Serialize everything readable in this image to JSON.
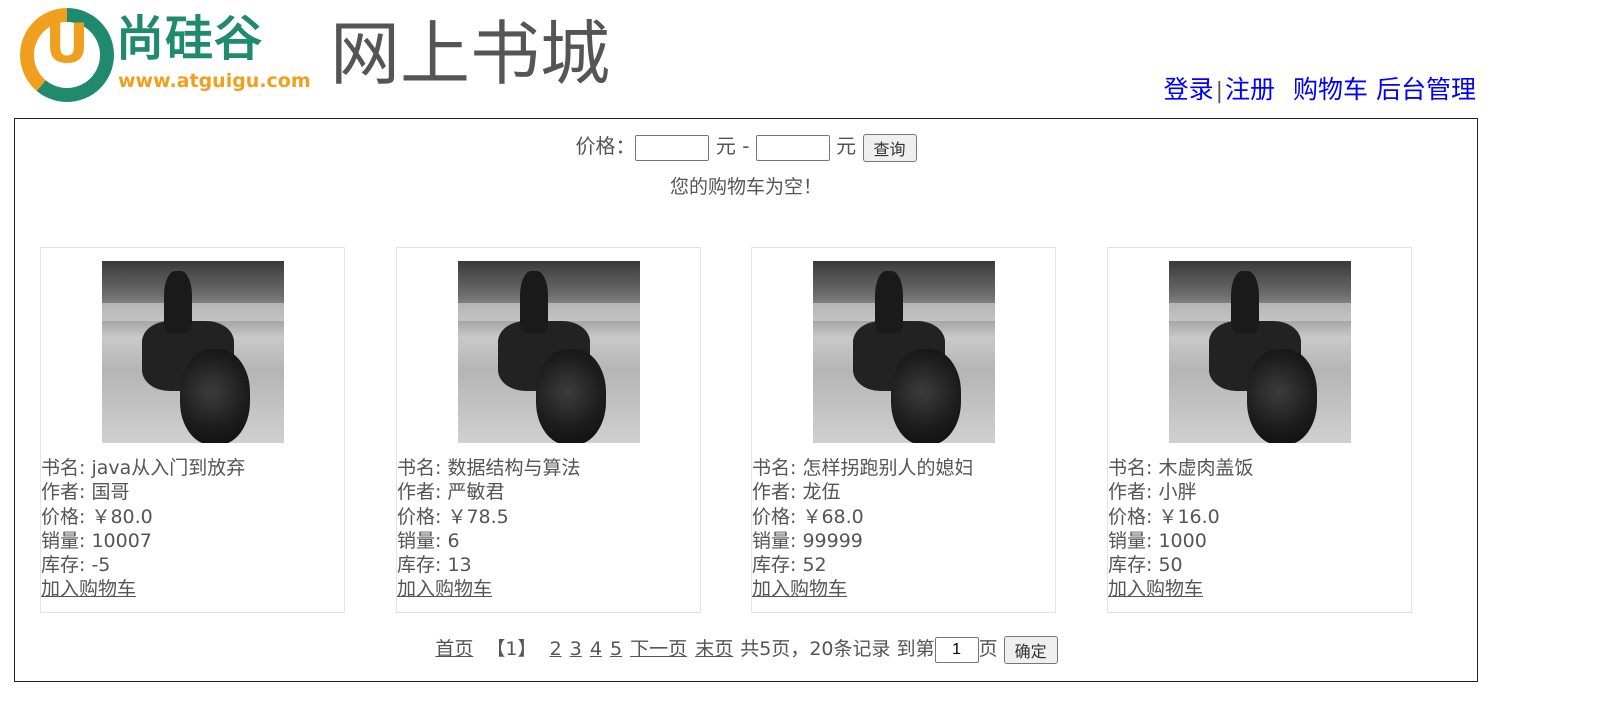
{
  "header": {
    "logo_cn": "尚硅谷",
    "logo_letter": "U",
    "logo_url": "www.atguigu.com",
    "site_title": "网上书城",
    "nav": {
      "login": "登录",
      "separator": "|",
      "register": "注册",
      "cart": "购物车",
      "admin": "后台管理"
    }
  },
  "search": {
    "price_label": "价格：",
    "min_value": "",
    "unit1": "元 -",
    "max_value": "",
    "unit2": "元",
    "query_button": "查询"
  },
  "cart_message": "您的购物车为空！",
  "books": [
    {
      "name_label": "书名:",
      "name": "java从入门到放弃",
      "author_label": "作者:",
      "author": "国哥",
      "price_label": "价格:",
      "price": "￥80.0",
      "sales_label": "销量:",
      "sales": "10007",
      "stock_label": "库存:",
      "stock": "-5",
      "add_to_cart": "加入购物车"
    },
    {
      "name_label": "书名:",
      "name": "数据结构与算法",
      "author_label": "作者:",
      "author": "严敏君",
      "price_label": "价格:",
      "price": "￥78.5",
      "sales_label": "销量:",
      "sales": "6",
      "stock_label": "库存:",
      "stock": "13",
      "add_to_cart": "加入购物车"
    },
    {
      "name_label": "书名:",
      "name": "怎样拐跑别人的媳妇",
      "author_label": "作者:",
      "author": "龙伍",
      "price_label": "价格:",
      "price": "￥68.0",
      "sales_label": "销量:",
      "sales": "99999",
      "stock_label": "库存:",
      "stock": "52",
      "add_to_cart": "加入购物车"
    },
    {
      "name_label": "书名:",
      "name": "木虚肉盖饭",
      "author_label": "作者:",
      "author": "小胖",
      "price_label": "价格:",
      "price": "￥16.0",
      "sales_label": "销量:",
      "sales": "1000",
      "stock_label": "库存:",
      "stock": "50",
      "add_to_cart": "加入购物车"
    }
  ],
  "pager": {
    "first": "首页",
    "current": "【1】",
    "pages": [
      "2",
      "3",
      "4",
      "5"
    ],
    "next": "下一页",
    "last": "末页",
    "summary": "共5页，20条记录 到第",
    "goto_value": "1",
    "page_suffix": "页",
    "confirm_button": "确定"
  }
}
